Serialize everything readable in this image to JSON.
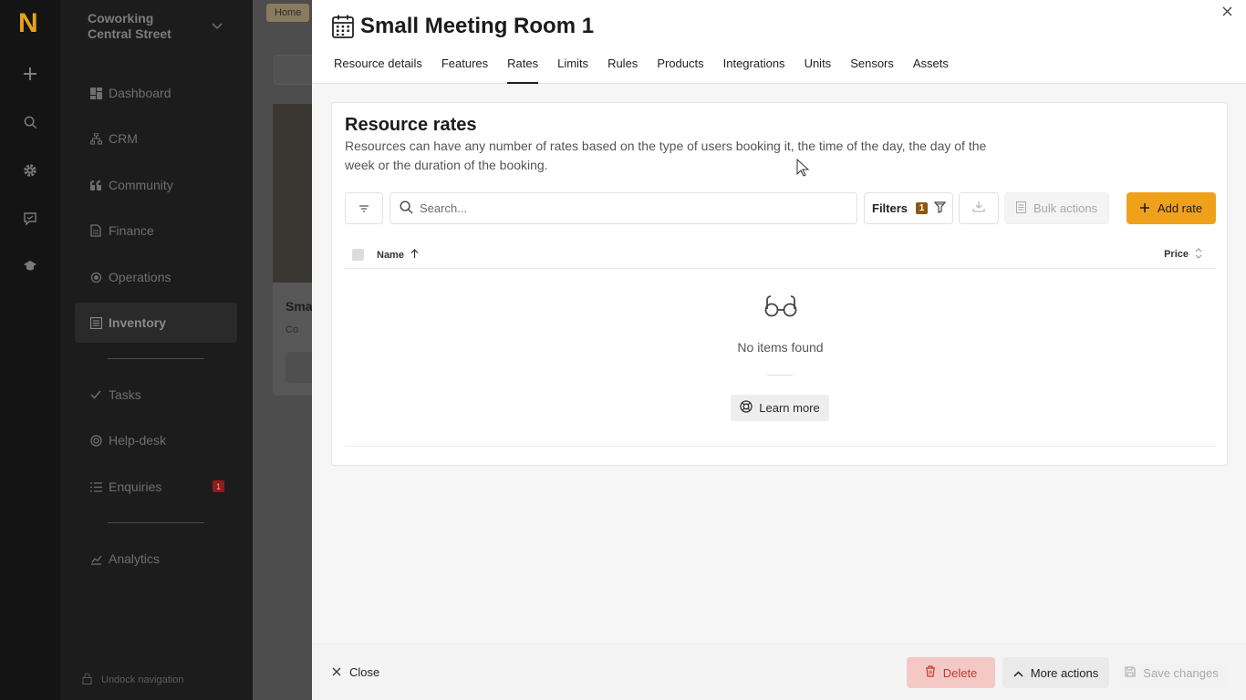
{
  "rail": {
    "logo": "N"
  },
  "sidebar": {
    "workspace": "Coworking Central Street",
    "items": [
      {
        "label": "Dashboard"
      },
      {
        "label": "CRM"
      },
      {
        "label": "Community"
      },
      {
        "label": "Finance"
      },
      {
        "label": "Operations"
      },
      {
        "label": "Inventory"
      },
      {
        "label": "Tasks"
      },
      {
        "label": "Help-desk"
      },
      {
        "label": "Enquiries",
        "badge": "1"
      },
      {
        "label": "Analytics"
      }
    ],
    "undock": "Undock navigation"
  },
  "background": {
    "breadcrumb": "Home",
    "card_title": "Sma",
    "card_location": "Co"
  },
  "modal": {
    "title": "Small Meeting Room 1",
    "tabs": [
      "Resource details",
      "Features",
      "Rates",
      "Limits",
      "Rules",
      "Products",
      "Integrations",
      "Units",
      "Sensors",
      "Assets"
    ],
    "active_tab": "Rates",
    "section": {
      "title": "Resource rates",
      "description": "Resources can have any number of rates based on the type of users booking it, the time of the day, the day of the week or the duration of the booking."
    },
    "toolbar": {
      "search_placeholder": "Search...",
      "filters_label": "Filters",
      "filters_count": "1",
      "bulk_label": "Bulk actions",
      "add_label": "Add rate"
    },
    "table": {
      "columns": [
        "Name",
        "Price"
      ],
      "rows": []
    },
    "empty": {
      "text": "No items found",
      "learn_more": "Learn more"
    },
    "footer": {
      "close_label": "Close",
      "delete_label": "Delete",
      "more_label": "More actions",
      "save_label": "Save changes"
    }
  },
  "colors": {
    "accent": "#f0a11c",
    "logo": "#e8a21a",
    "danger_bg": "#f4c9c5",
    "danger_text": "#c43a33"
  }
}
